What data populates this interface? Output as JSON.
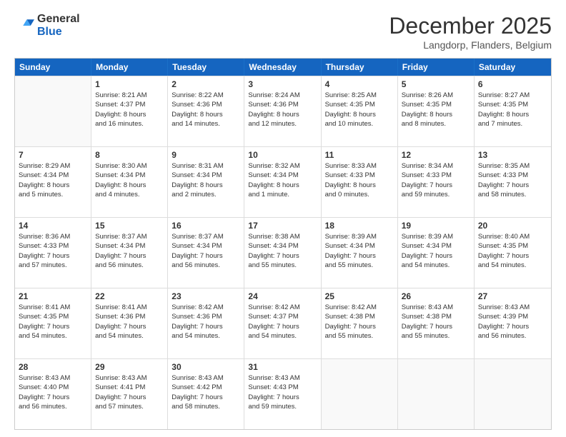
{
  "logo": {
    "general": "General",
    "blue": "Blue"
  },
  "header": {
    "month": "December 2025",
    "location": "Langdorp, Flanders, Belgium"
  },
  "weekdays": [
    "Sunday",
    "Monday",
    "Tuesday",
    "Wednesday",
    "Thursday",
    "Friday",
    "Saturday"
  ],
  "weeks": [
    [
      {
        "day": "",
        "empty": true
      },
      {
        "day": "1",
        "sunrise": "Sunrise: 8:21 AM",
        "sunset": "Sunset: 4:37 PM",
        "daylight": "Daylight: 8 hours and 16 minutes."
      },
      {
        "day": "2",
        "sunrise": "Sunrise: 8:22 AM",
        "sunset": "Sunset: 4:36 PM",
        "daylight": "Daylight: 8 hours and 14 minutes."
      },
      {
        "day": "3",
        "sunrise": "Sunrise: 8:24 AM",
        "sunset": "Sunset: 4:36 PM",
        "daylight": "Daylight: 8 hours and 12 minutes."
      },
      {
        "day": "4",
        "sunrise": "Sunrise: 8:25 AM",
        "sunset": "Sunset: 4:35 PM",
        "daylight": "Daylight: 8 hours and 10 minutes."
      },
      {
        "day": "5",
        "sunrise": "Sunrise: 8:26 AM",
        "sunset": "Sunset: 4:35 PM",
        "daylight": "Daylight: 8 hours and 8 minutes."
      },
      {
        "day": "6",
        "sunrise": "Sunrise: 8:27 AM",
        "sunset": "Sunset: 4:35 PM",
        "daylight": "Daylight: 8 hours and 7 minutes."
      }
    ],
    [
      {
        "day": "7",
        "sunrise": "Sunrise: 8:29 AM",
        "sunset": "Sunset: 4:34 PM",
        "daylight": "Daylight: 8 hours and 5 minutes."
      },
      {
        "day": "8",
        "sunrise": "Sunrise: 8:30 AM",
        "sunset": "Sunset: 4:34 PM",
        "daylight": "Daylight: 8 hours and 4 minutes."
      },
      {
        "day": "9",
        "sunrise": "Sunrise: 8:31 AM",
        "sunset": "Sunset: 4:34 PM",
        "daylight": "Daylight: 8 hours and 2 minutes."
      },
      {
        "day": "10",
        "sunrise": "Sunrise: 8:32 AM",
        "sunset": "Sunset: 4:34 PM",
        "daylight": "Daylight: 8 hours and 1 minute."
      },
      {
        "day": "11",
        "sunrise": "Sunrise: 8:33 AM",
        "sunset": "Sunset: 4:33 PM",
        "daylight": "Daylight: 8 hours and 0 minutes."
      },
      {
        "day": "12",
        "sunrise": "Sunrise: 8:34 AM",
        "sunset": "Sunset: 4:33 PM",
        "daylight": "Daylight: 7 hours and 59 minutes."
      },
      {
        "day": "13",
        "sunrise": "Sunrise: 8:35 AM",
        "sunset": "Sunset: 4:33 PM",
        "daylight": "Daylight: 7 hours and 58 minutes."
      }
    ],
    [
      {
        "day": "14",
        "sunrise": "Sunrise: 8:36 AM",
        "sunset": "Sunset: 4:33 PM",
        "daylight": "Daylight: 7 hours and 57 minutes."
      },
      {
        "day": "15",
        "sunrise": "Sunrise: 8:37 AM",
        "sunset": "Sunset: 4:34 PM",
        "daylight": "Daylight: 7 hours and 56 minutes."
      },
      {
        "day": "16",
        "sunrise": "Sunrise: 8:37 AM",
        "sunset": "Sunset: 4:34 PM",
        "daylight": "Daylight: 7 hours and 56 minutes."
      },
      {
        "day": "17",
        "sunrise": "Sunrise: 8:38 AM",
        "sunset": "Sunset: 4:34 PM",
        "daylight": "Daylight: 7 hours and 55 minutes."
      },
      {
        "day": "18",
        "sunrise": "Sunrise: 8:39 AM",
        "sunset": "Sunset: 4:34 PM",
        "daylight": "Daylight: 7 hours and 55 minutes."
      },
      {
        "day": "19",
        "sunrise": "Sunrise: 8:39 AM",
        "sunset": "Sunset: 4:34 PM",
        "daylight": "Daylight: 7 hours and 54 minutes."
      },
      {
        "day": "20",
        "sunrise": "Sunrise: 8:40 AM",
        "sunset": "Sunset: 4:35 PM",
        "daylight": "Daylight: 7 hours and 54 minutes."
      }
    ],
    [
      {
        "day": "21",
        "sunrise": "Sunrise: 8:41 AM",
        "sunset": "Sunset: 4:35 PM",
        "daylight": "Daylight: 7 hours and 54 minutes."
      },
      {
        "day": "22",
        "sunrise": "Sunrise: 8:41 AM",
        "sunset": "Sunset: 4:36 PM",
        "daylight": "Daylight: 7 hours and 54 minutes."
      },
      {
        "day": "23",
        "sunrise": "Sunrise: 8:42 AM",
        "sunset": "Sunset: 4:36 PM",
        "daylight": "Daylight: 7 hours and 54 minutes."
      },
      {
        "day": "24",
        "sunrise": "Sunrise: 8:42 AM",
        "sunset": "Sunset: 4:37 PM",
        "daylight": "Daylight: 7 hours and 54 minutes."
      },
      {
        "day": "25",
        "sunrise": "Sunrise: 8:42 AM",
        "sunset": "Sunset: 4:38 PM",
        "daylight": "Daylight: 7 hours and 55 minutes."
      },
      {
        "day": "26",
        "sunrise": "Sunrise: 8:43 AM",
        "sunset": "Sunset: 4:38 PM",
        "daylight": "Daylight: 7 hours and 55 minutes."
      },
      {
        "day": "27",
        "sunrise": "Sunrise: 8:43 AM",
        "sunset": "Sunset: 4:39 PM",
        "daylight": "Daylight: 7 hours and 56 minutes."
      }
    ],
    [
      {
        "day": "28",
        "sunrise": "Sunrise: 8:43 AM",
        "sunset": "Sunset: 4:40 PM",
        "daylight": "Daylight: 7 hours and 56 minutes."
      },
      {
        "day": "29",
        "sunrise": "Sunrise: 8:43 AM",
        "sunset": "Sunset: 4:41 PM",
        "daylight": "Daylight: 7 hours and 57 minutes."
      },
      {
        "day": "30",
        "sunrise": "Sunrise: 8:43 AM",
        "sunset": "Sunset: 4:42 PM",
        "daylight": "Daylight: 7 hours and 58 minutes."
      },
      {
        "day": "31",
        "sunrise": "Sunrise: 8:43 AM",
        "sunset": "Sunset: 4:43 PM",
        "daylight": "Daylight: 7 hours and 59 minutes."
      },
      {
        "day": "",
        "empty": true
      },
      {
        "day": "",
        "empty": true
      },
      {
        "day": "",
        "empty": true
      }
    ]
  ]
}
